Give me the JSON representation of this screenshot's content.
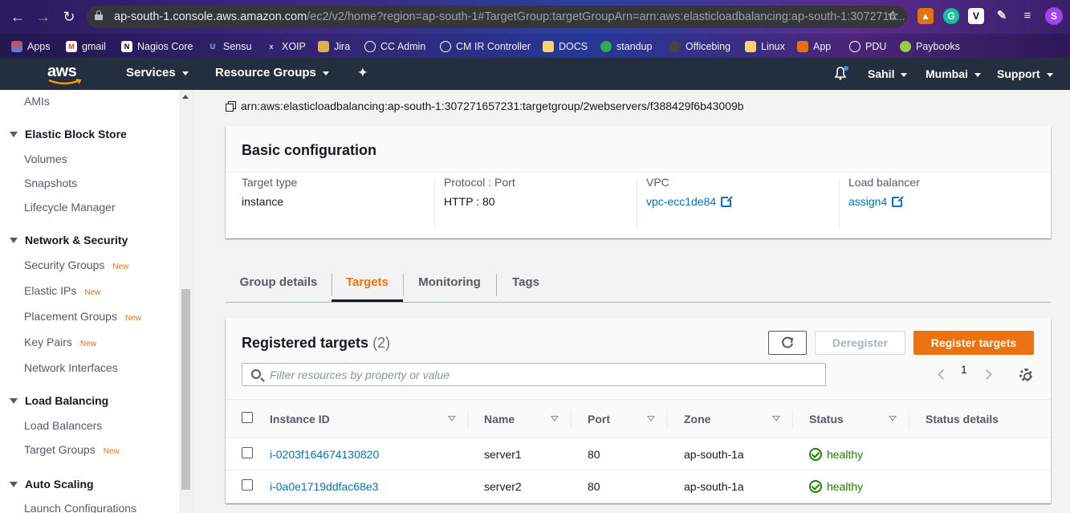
{
  "browser": {
    "url_host": "ap-south-1.console.aws.amazon.com",
    "url_path": "/ec2/v2/home?region=ap-south-1#TargetGroup:targetGroupArn=arn:aws:elasticloadbalancing:ap-south-1:3072716...",
    "bookmarks": [
      "Apps",
      "gmail",
      "Nagios Core",
      "Sensu",
      "XOIP",
      "Jira",
      "CC Admin",
      "CM IR Controller",
      "DOCS",
      "standup",
      "Officebing",
      "Linux",
      "App",
      "PDU",
      "Paybooks"
    ],
    "profile_initial": "S"
  },
  "header": {
    "logo": "aws",
    "services": "Services",
    "resource_groups": "Resource Groups",
    "user": "Sahil",
    "region": "Mumbai",
    "support": "Support"
  },
  "sidebar": {
    "amis": "AMIs",
    "ebs_section": "Elastic Block Store",
    "volumes": "Volumes",
    "snapshots": "Snapshots",
    "lifecycle": "Lifecycle Manager",
    "netsec_section": "Network & Security",
    "security_groups": "Security Groups",
    "elastic_ips": "Elastic IPs",
    "placement_groups": "Placement Groups",
    "key_pairs": "Key Pairs",
    "network_interfaces": "Network Interfaces",
    "lb_section": "Load Balancing",
    "load_balancers": "Load Balancers",
    "target_groups": "Target Groups",
    "as_section": "Auto Scaling",
    "launch_configs": "Launch Configurations",
    "new_badge": "New"
  },
  "arn": "arn:aws:elasticloadbalancing:ap-south-1:307271657231:targetgroup/2webservers/f388429f6b43009b",
  "basic": {
    "title": "Basic configuration",
    "target_type_label": "Target type",
    "target_type": "instance",
    "protocol_label": "Protocol : Port",
    "protocol": "HTTP : 80",
    "vpc_label": "VPC",
    "vpc": "vpc-ecc1de84",
    "lb_label": "Load balancer",
    "lb": "assign4"
  },
  "tabs": [
    "Group details",
    "Targets",
    "Monitoring",
    "Tags"
  ],
  "active_tab": "Targets",
  "targets": {
    "title": "Registered targets",
    "count": "(2)",
    "deregister": "Deregister",
    "register": "Register targets",
    "filter_placeholder": "Filter resources by property or value",
    "page": "1",
    "columns": [
      "Instance ID",
      "Name",
      "Port",
      "Zone",
      "Status",
      "Status details"
    ],
    "rows": [
      {
        "instance_id": "i-0203f164674130820",
        "name": "server1",
        "port": "80",
        "zone": "ap-south-1a",
        "status": "healthy",
        "details": ""
      },
      {
        "instance_id": "i-0a0e1719ddfac68e3",
        "name": "server2",
        "port": "80",
        "zone": "ap-south-1a",
        "status": "healthy",
        "details": ""
      }
    ]
  },
  "colors": {
    "accent": "#ec7211",
    "link": "#0073bb",
    "healthy": "#1d8102",
    "header": "#232f3e"
  }
}
